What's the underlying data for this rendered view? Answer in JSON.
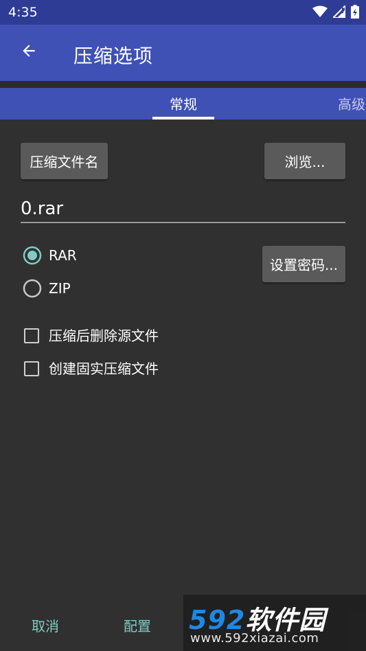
{
  "status_bar": {
    "time": "4:35",
    "icons": [
      "wifi-icon",
      "signal-icon",
      "battery-charging-icon"
    ]
  },
  "app_bar": {
    "back_icon": "arrow-left-icon",
    "title": "压缩选项"
  },
  "tabs": [
    {
      "label": "常规",
      "selected": true
    },
    {
      "label": "高级",
      "selected": false
    }
  ],
  "general": {
    "archive_name_button": "压缩文件名",
    "browse_button": "浏览...",
    "filename_value": "0.rar",
    "format_options": [
      {
        "label": "RAR",
        "selected": true
      },
      {
        "label": "ZIP",
        "selected": false
      }
    ],
    "set_password_button": "设置密码...",
    "checkboxes": [
      {
        "label": "压缩后删除源文件",
        "checked": false
      },
      {
        "label": "创建固实压缩文件",
        "checked": false
      }
    ]
  },
  "footer": {
    "cancel": "取消",
    "profiles": "配置"
  },
  "watermark": {
    "logo": "592软件园",
    "url": "www.592xiazai.com"
  },
  "colors": {
    "primary": "#3f51b5",
    "primary_dark": "#2f3c95",
    "background": "#303030",
    "accent": "#80cbc4",
    "button": "#5a5a5a"
  }
}
